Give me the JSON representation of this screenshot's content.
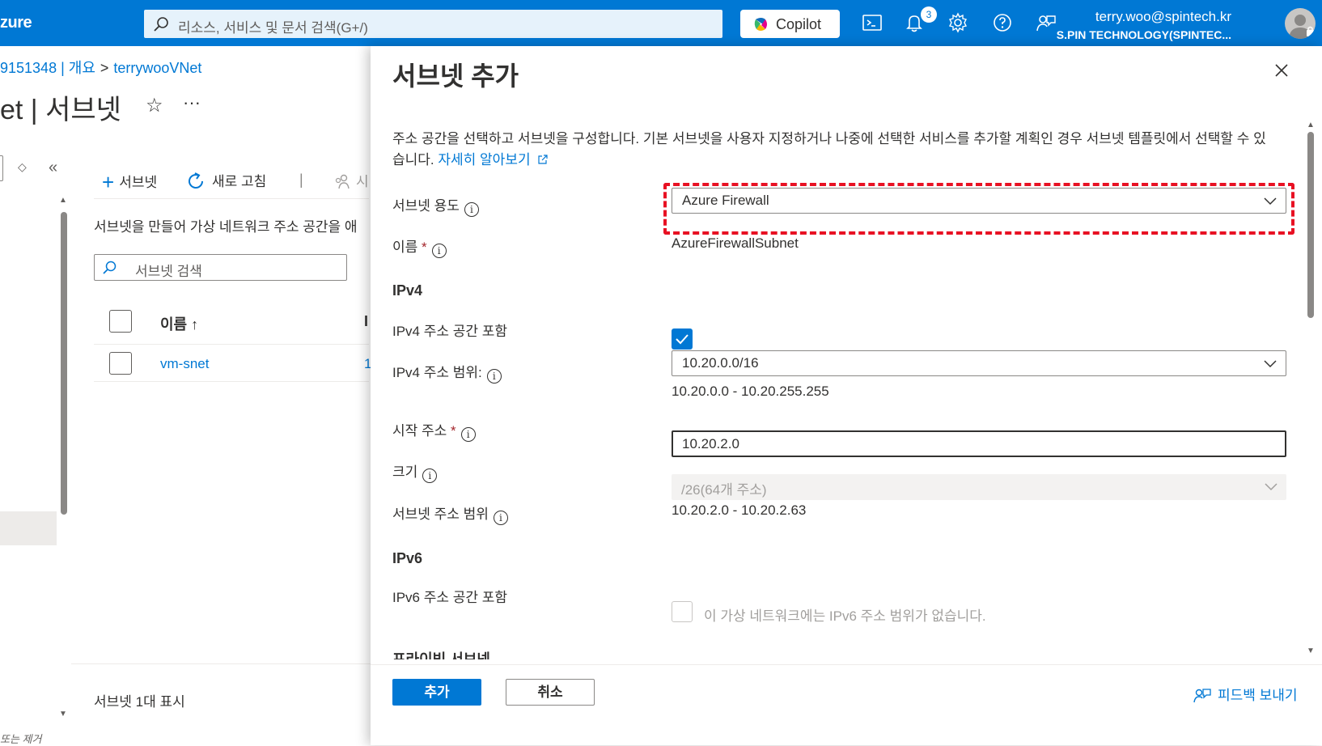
{
  "topbar": {
    "brand": "zure",
    "search_placeholder": "리소스, 서비스 및 문서 검색(G+/)",
    "copilot_label": "Copilot",
    "notification_count": "3",
    "user_email": "terry.woo@spintech.kr",
    "user_tenant": "S.PIN TECHNOLOGY(SPINTEC...",
    "icons": [
      "search-icon",
      "cloud-shell-icon",
      "bell-icon",
      "gear-icon",
      "help-icon",
      "feedback-icon",
      "avatar"
    ],
    "colors": {
      "bar": "#0078d4"
    }
  },
  "background_blade": {
    "breadcrumb": {
      "item1": "9151348 | 개요",
      "separator": ">",
      "item2": "terrywooVNet"
    },
    "title": "et | 서브넷",
    "star": "☆",
    "more": "···",
    "commands": {
      "add": "서브넷",
      "refresh": "새로 고침",
      "divider": "|",
      "people": "시"
    },
    "description": "서브넷을 만들어 가상 네트워크 주소 공간을 애",
    "search_placeholder": "서브넷 검색",
    "table": {
      "headers": {
        "name": "이름 ↑",
        "ip": "I"
      },
      "rows": [
        {
          "name": "vm-snet",
          "ip": "1"
        }
      ]
    },
    "footer": "서브넷 1대 표시",
    "bottom_left": "또는 제거"
  },
  "panel": {
    "title": "서브넷 추가",
    "description": "주소 공간을 선택하고 서브넷을 구성합니다. 기본 서브넷을 사용자 지정하거나 나중에 선택한 서비스를 추가할 계획인 경우 서브넷 템플릿에서 선택할 수 있습니다.",
    "learn_more": "자세히 알아보기",
    "fields": {
      "purpose_label": "서브넷 용도",
      "purpose_value": "Azure Firewall",
      "name_label": "이름",
      "name_value": "AzureFirewallSubnet",
      "ipv4_section": "IPv4",
      "ipv4_include_label": "IPv4 주소 공간 포함",
      "ipv4_include_checked": true,
      "ipv4_range_label": "IPv4 주소 범위:",
      "ipv4_range_value": "10.20.0.0/16",
      "ipv4_range_span": "10.20.0.0 - 10.20.255.255",
      "start_label": "시작 주소",
      "start_value": "10.20.2.0",
      "size_label": "크기",
      "size_value": "/26(64개 주소)",
      "subnet_range_label": "서브넷 주소 범위",
      "subnet_range_value": "10.20.2.0 - 10.20.2.63",
      "ipv6_section": "IPv6",
      "ipv6_include_label": "IPv6 주소 공간 포함",
      "ipv6_include_checked": false,
      "ipv6_note": "이 가상 네트워크에는 IPv6 주소 범위가 없습니다.",
      "next_section": "프라이빗 서브넷"
    },
    "required_mark": "*",
    "info_glyph": "i",
    "buttons": {
      "add": "추가",
      "cancel": "취소"
    },
    "feedback": "피드백 보내기",
    "colors": {
      "primary": "#0078d4",
      "highlight": "#e81123"
    }
  }
}
